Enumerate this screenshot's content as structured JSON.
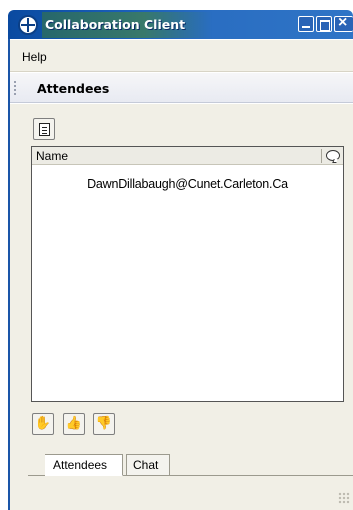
{
  "window": {
    "title": "Collaboration Client"
  },
  "menubar": {
    "help_label": "Help"
  },
  "section": {
    "title": "Attendees"
  },
  "toolbar": {
    "document_icon": "document-icon"
  },
  "attendees_list": {
    "columns": {
      "name": "Name",
      "status_icon": "speech-bubble-icon"
    },
    "rows": [
      {
        "name": "DawnDillabaugh@Cunet.Carleton.Ca"
      }
    ]
  },
  "actions": {
    "icons": [
      "raise-hand-icon",
      "thumbs-up-icon",
      "thumbs-down-icon"
    ]
  },
  "tabs": [
    {
      "label": "Attendees",
      "selected": true
    },
    {
      "label": "Chat",
      "selected": false
    }
  ],
  "colors": {
    "titlebar": "#0a4aa0",
    "panel_bg": "#f1efe6"
  }
}
